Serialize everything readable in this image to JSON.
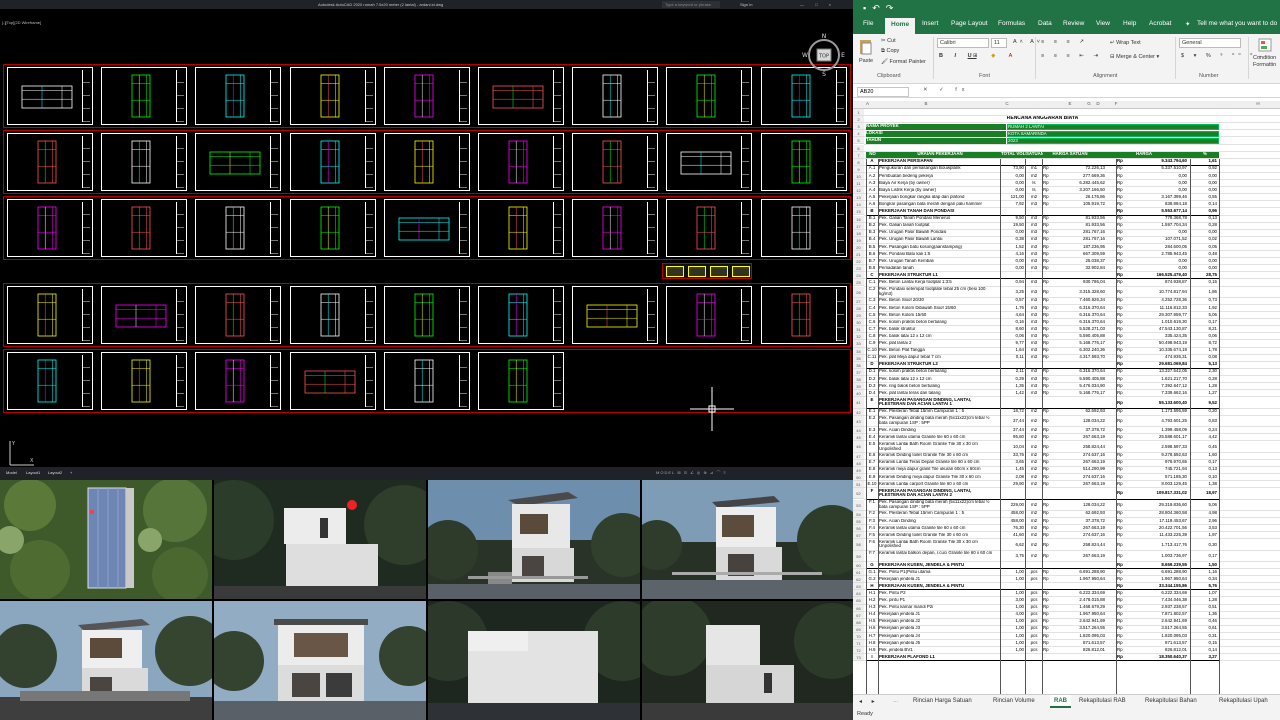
{
  "autocad": {
    "title": "Autodesk AutoCAD 2020   rumah 7.5x20 meter (2 lantai) - ardani.id.dwg",
    "search_placeholder": "Type a keyword or phrase",
    "user": "Sign In",
    "window_controls": "— □ ×",
    "viewport_label": "[-][Top][2D Wireframe]",
    "viewcube": {
      "face": "TOP",
      "north": "N",
      "south": "S",
      "east": "E",
      "west": "W"
    },
    "layout_tabs": [
      "Model",
      "Layout1",
      "Layout2",
      "+"
    ],
    "status_text": "MODEL  ⊞ ⊡ ∠ ◎ ⊕ ⊿ ⌒ ≡",
    "ucs": {
      "x": "X",
      "y": "Y"
    }
  },
  "excel": {
    "qat_icons": [
      "save-icon",
      "undo-icon",
      "redo-icon"
    ],
    "tabs": [
      "File",
      "Home",
      "Insert",
      "Page Layout",
      "Formulas",
      "Data",
      "Review",
      "View",
      "Help",
      "Acrobat",
      "Tell me what you want to do"
    ],
    "active_tab": "Home",
    "ribbon": {
      "paste": "Paste",
      "cut": "Cut",
      "copy": "Copy",
      "format_painter": "Format Painter",
      "clipboard": "Clipboard",
      "font_name": "Calibri",
      "font_size": "11",
      "font": "Font",
      "wrap_text": "Wrap Text",
      "merge_center": "Merge & Center",
      "alignment": "Alignment",
      "number_format": "General",
      "number": "Number",
      "conditional": "Condition\nFormattin"
    },
    "name_box": "AB20",
    "fx": "✕ ✓ fx",
    "columns": [
      "A",
      "B",
      "C",
      "D",
      "E",
      "F",
      "G",
      "H"
    ],
    "sheet_tabs": [
      "Rincian Harga Satuan",
      "Rincian Volume",
      "RAB",
      "Rekapitulasi RAB",
      "Rekapitulasi Bahan",
      "Rekapitulasi Upah"
    ],
    "active_sheet": "RAB",
    "status": "Ready",
    "doc_title": "RENCANA ANGGARAN BIAYA",
    "info": [
      {
        "label": "NAMA PROYEK",
        "value": "RUMAH 2 LANTAI"
      },
      {
        "label": "LOKASI",
        "value": "KOTA SAMARINDA"
      },
      {
        "label": "TAHUN",
        "value": "2023"
      }
    ],
    "header": [
      "NO",
      "URAIAN PEKERJAAN",
      "TOTAL VOLUM",
      "SATUAN",
      "HARGA SATUAN",
      "HARGA",
      "%"
    ],
    "rows": [
      {
        "r": "8",
        "no": "A",
        "desc": "PEKERJAAN PERSIAPAN",
        "vol": "",
        "sat": "",
        "hs": "",
        "rp": "Rp",
        "harga": "9.343.794,60",
        "pct": "1,61",
        "type": "sec"
      },
      {
        "r": "9",
        "no": "A.1",
        "desc": "Pengukuran dan pemasangan Bouwplank",
        "vol": "73,90",
        "sat": "m1",
        "hs": "72.226,13",
        "rp": "Rp",
        "harga": "5.337.510,97",
        "pct": "0,92"
      },
      {
        "r": "10",
        "no": "A.2",
        "desc": "Pembuatan bedeng pekerja",
        "vol": "0,00",
        "sat": "m2",
        "hs": "277.669,36",
        "rp": "Rp",
        "harga": "0,00",
        "pct": "0,00"
      },
      {
        "r": "11",
        "no": "A.3",
        "desc": "Biaya Air Kerja (by owner)",
        "vol": "0,00",
        "sat": "ls",
        "hs": "6.282.445,62",
        "rp": "Rp",
        "harga": "0,00",
        "pct": "0,00"
      },
      {
        "r": "12",
        "no": "A.4",
        "desc": "Biaya Listrik Kerja (by owner)",
        "vol": "0,00",
        "sat": "ls",
        "hs": "3.207.166,50",
        "rp": "Rp",
        "harga": "0,00",
        "pct": "0,00"
      },
      {
        "r": "13",
        "no": "A.5",
        "desc": "Pekerjaan bongkar rangka atap dan plafond",
        "vol": "121,00",
        "sat": "m2",
        "hs": "26.176,86",
        "rp": "Rp",
        "harga": "3.167.399,46",
        "pct": "0,55"
      },
      {
        "r": "14",
        "no": "A.6",
        "desc": "Bongkar pasangan bata merah dengan palu hammer",
        "vol": "7,92",
        "sat": "m3",
        "hs": "105.919,72",
        "rp": "Rp",
        "harga": "838.884,18",
        "pct": "0,14"
      },
      {
        "r": "15",
        "no": "B",
        "desc": "PEKERJAAN TANAH DAN PONDASI",
        "vol": "",
        "sat": "",
        "hs": "",
        "rp": "Rp",
        "harga": "5.553.677,14",
        "pct": "0,96",
        "type": "sec"
      },
      {
        "r": "16",
        "no": "B.1",
        "desc": "Pek. Galian Tanah Pondasi Menerus",
        "vol": "9,50",
        "sat": "m3",
        "hs": "81.933,56",
        "rp": "Rp",
        "harga": "778.368,78",
        "pct": "0,13"
      },
      {
        "r": "17",
        "no": "B.2",
        "desc": "Pek. Galian tanah footplat",
        "vol": "19,50",
        "sat": "m3",
        "hs": "81.933,56",
        "rp": "Rp",
        "harga": "1.597.704,34",
        "pct": "0,28"
      },
      {
        "r": "18",
        "no": "B.3",
        "desc": "Pek. Urugan Pasir Bawah Pondasi",
        "vol": "0,00",
        "sat": "m3",
        "hs": "281.767,16",
        "rp": "Rp",
        "harga": "0,00",
        "pct": "0,00"
      },
      {
        "r": "19",
        "no": "B.4",
        "desc": "Pek. Urugan Pasir Bawah Lantai",
        "vol": "0,38",
        "sat": "m3",
        "hs": "281.767,16",
        "rp": "Rp",
        "harga": "107.071,52",
        "pct": "0,02"
      },
      {
        "r": "20",
        "no": "B.5",
        "desc": "Pek. Pasangan batu kosong(aanstamping)",
        "vol": "1,52",
        "sat": "m3",
        "hs": "187.236,95",
        "rp": "Rp",
        "harga": "284.600,05",
        "pct": "0,05"
      },
      {
        "r": "21",
        "no": "B.6",
        "desc": "Pek. Pondasi Batu kali 1:5",
        "vol": "4,16",
        "sat": "m3",
        "hs": "667.309,59",
        "rp": "Rp",
        "harga": "2.785.943,45",
        "pct": "0,48"
      },
      {
        "r": "22",
        "no": "B.7",
        "desc": "Pek. Urugan Tanah Kembali",
        "vol": "0,00",
        "sat": "m3",
        "hs": "25.038,37",
        "rp": "Rp",
        "harga": "0,00",
        "pct": "0,00"
      },
      {
        "r": "23",
        "no": "B.8",
        "desc": "Pemadatan tanah",
        "vol": "0,00",
        "sat": "m3",
        "hs": "32.902,84",
        "rp": "Rp",
        "harga": "0,00",
        "pct": "0,00"
      },
      {
        "r": "24",
        "no": "C",
        "desc": "PEKERJAAN STRUKTUR L1",
        "vol": "",
        "sat": "",
        "hs": "",
        "rp": "Rp",
        "harga": "166.525.479,40",
        "pct": "28,75",
        "type": "sec"
      },
      {
        "r": "25",
        "no": "C.1",
        "desc": "Pek. Beton Lantai Kerja footplat 1:3:5",
        "vol": "0,94",
        "sat": "m3",
        "hs": "930.786,04",
        "rp": "Rp",
        "harga": "874.938,87",
        "pct": "0,15"
      },
      {
        "r": "26",
        "no": "C.2",
        "desc": "Pek. Pondasi setempat footplate tebal 25 cm (besi 100 kg/m3)",
        "vol": "3,25",
        "sat": "m3",
        "hs": "3.315.328,60",
        "rp": "Rp",
        "harga": "10.774.817,94",
        "pct": "1,86",
        "tall": true
      },
      {
        "r": "27",
        "no": "C.3",
        "desc": "Pek. Beton Sloof 20/30",
        "vol": "0,57",
        "sat": "m3",
        "hs": "7.460.926,34",
        "rp": "Rp",
        "harga": "4.252.728,36",
        "pct": "0,73"
      },
      {
        "r": "28",
        "no": "C.4",
        "desc": "Pek. Beton Kolom Dibawah Sloof 15/60",
        "vol": "1,76",
        "sat": "m3",
        "hs": "6.316.370,64",
        "rp": "Rp",
        "harga": "11.116.812,33",
        "pct": "1,92"
      },
      {
        "r": "29",
        "no": "C.5",
        "desc": "Pek. Beton Kolom 15/60",
        "vol": "4,64",
        "sat": "m3",
        "hs": "6.316.370,64",
        "rp": "Rp",
        "harga": "29.307.959,77",
        "pct": "5,06"
      },
      {
        "r": "30",
        "no": "C.6",
        "desc": "Pek. kolom praktis beton bertulang",
        "vol": "0,16",
        "sat": "m3",
        "hs": "6.316.370,64",
        "rp": "Rp",
        "harga": "1.010.619,30",
        "pct": "0,17"
      },
      {
        "r": "31",
        "no": "C.7",
        "desc": "Pek. balok struktur",
        "vol": "8,60",
        "sat": "m3",
        "hs": "5.528.271,03",
        "rp": "Rp",
        "harga": "47.543.130,87",
        "pct": "8,21"
      },
      {
        "r": "32",
        "no": "C.8",
        "desc": "Pek. balok latai 12 x 12 cm",
        "vol": "0,06",
        "sat": "m3",
        "hs": "5.590.405,88",
        "rp": "Rp",
        "harga": "335.424,35",
        "pct": "0,06"
      },
      {
        "r": "33",
        "no": "C.9",
        "desc": "Pek. plat lantai 2",
        "vol": "9,77",
        "sat": "m3",
        "hs": "5.168.776,17",
        "rp": "Rp",
        "harga": "50.498.943,19",
        "pct": "8,72"
      },
      {
        "r": "34",
        "no": "C.10",
        "desc": "Pek. Beton Plat Tangga",
        "vol": "1,64",
        "sat": "m3",
        "hs": "6.302.240,36",
        "rp": "Rp",
        "harga": "10.335.674,19",
        "pct": "1,78"
      },
      {
        "r": "35",
        "no": "C.11",
        "desc": "Pek. plat Meja dapur tebal 7 cm",
        "vol": "0,11",
        "sat": "m3",
        "hs": "4.317.593,70",
        "rp": "Rp",
        "harga": "474.935,31",
        "pct": "0,08"
      },
      {
        "r": "36",
        "no": "D",
        "desc": "PEKERJAAN STRUKTUR L2",
        "vol": "",
        "sat": "",
        "hs": "",
        "rp": "Rp",
        "harga": "29.681.069,84",
        "pct": "5,13",
        "type": "sec"
      },
      {
        "r": "37",
        "no": "D.1",
        "desc": "Pek. kolom praktis beton bertulang",
        "vol": "2,11",
        "sat": "m3",
        "hs": "6.316.370,64",
        "rp": "Rp",
        "harga": "13.327.542,05",
        "pct": "2,30"
      },
      {
        "r": "38",
        "no": "D.2",
        "desc": "Pek. balok latai 12 x 12 cm",
        "vol": "0,29",
        "sat": "m3",
        "hs": "5.590.405,88",
        "rp": "Rp",
        "harga": "1.621.217,70",
        "pct": "0,28"
      },
      {
        "r": "39",
        "no": "D.3",
        "desc": "Pek. ring balok beton bertulang",
        "vol": "1,35",
        "sat": "m3",
        "hs": "5.476.034,90",
        "rp": "Rp",
        "harga": "7.392.647,12",
        "pct": "1,28"
      },
      {
        "r": "40",
        "no": "D.4",
        "desc": "Pek. plat lantai teras dan talang",
        "vol": "1,42",
        "sat": "m3",
        "hs": "5.168.776,17",
        "rp": "Rp",
        "harga": "7.339.662,16",
        "pct": "1,27"
      },
      {
        "r": "41",
        "no": "E",
        "desc": "PEKERJAAN PASANGAN DINDING, LANTAI, PLESTERAN DAN ACIAN LANTAI 1",
        "vol": "",
        "sat": "",
        "hs": "",
        "rp": "Rp",
        "harga": "55.133.600,40",
        "pct": "9,52",
        "type": "sec",
        "tall": true
      },
      {
        "r": "42",
        "no": "E.1",
        "desc": "Pek. Plesteran Tebal 15mm Campuran 1 : 5",
        "vol": "18,72",
        "sat": "m2",
        "hs": "62.692,93",
        "rp": "Rp",
        "harga": "1.173.595,59",
        "pct": "0,20"
      },
      {
        "r": "43",
        "no": "E.2",
        "desc": "Pek. Pasangan dinding bata merah (5x11x22)cm tebal ½ bata campuran 1SP : 5PP",
        "vol": "37,44",
        "sat": "m2",
        "hs": "128.034,22",
        "rp": "Rp",
        "harga": "4.793.601,25",
        "pct": "0,83",
        "tall": true
      },
      {
        "r": "44",
        "no": "E.3",
        "desc": "Pek. Acian Dinding",
        "vol": "37,44",
        "sat": "m2",
        "hs": "37.378,72",
        "rp": "Rp",
        "harga": "1.399.458,09",
        "pct": "0,24"
      },
      {
        "r": "45",
        "no": "E.4",
        "desc": "Keramik lantai utama Granite tile 60 x 60 cm",
        "vol": "95,60",
        "sat": "m2",
        "hs": "267.663,19",
        "rp": "Rp",
        "harga": "25.588.601,17",
        "pct": "4,42"
      },
      {
        "r": "46",
        "no": "E.5",
        "desc": "Keramik Lantai Bath Room Granite Tile 30 x 30 cm Unpolished",
        "vol": "10,04",
        "sat": "m2",
        "hs": "258.824,44",
        "rp": "Rp",
        "harga": "2.598.597,33",
        "pct": "0,45",
        "tall": true
      },
      {
        "r": "47",
        "no": "E.6",
        "desc": "Keramik Dinding toilet Granite Tile 30 x 60 cm",
        "vol": "33,76",
        "sat": "m2",
        "hs": "274.637,16",
        "rp": "Rp",
        "harga": "9.278.592,63",
        "pct": "1,60"
      },
      {
        "r": "48",
        "no": "E.7",
        "desc": "Keramik Lantai Teras Depan Granite tile 60 x 60 cm",
        "vol": "3,65",
        "sat": "m2",
        "hs": "267.663,19",
        "rp": "Rp",
        "harga": "976.970,65",
        "pct": "0,17"
      },
      {
        "r": "49",
        "no": "E.8",
        "desc": "Keramik meja dapur granit Tile ukuran 60cm x 60cm",
        "vol": "1,45",
        "sat": "m2",
        "hs": "514.290,99",
        "rp": "Rp",
        "harga": "745.721,94",
        "pct": "0,13"
      },
      {
        "r": "50",
        "no": "E.9",
        "desc": "Keramik Dinding meja dapur Granite Tile 30 x 60 cm",
        "vol": "2,08",
        "sat": "m2",
        "hs": "274.637,16",
        "rp": "Rp",
        "harga": "571.185,30",
        "pct": "0,10"
      },
      {
        "r": "51",
        "no": "E.10",
        "desc": "Keramik Lantai carport Granite tile 60 x 60 cm",
        "vol": "29,90",
        "sat": "m2",
        "hs": "267.663,19",
        "rp": "Rp",
        "harga": "8.003.129,45",
        "pct": "1,38"
      },
      {
        "r": "52",
        "no": "F",
        "desc": "PEKERJAAN PASANGAN DINDING, LANTAI, PLESTERAN DAN ACIAN LANTAI 2",
        "vol": "",
        "sat": "",
        "hs": "",
        "rp": "Rp",
        "harga": "109.817.331,02",
        "pct": "18,97",
        "type": "sec",
        "tall": true
      },
      {
        "r": "53",
        "no": "F.1",
        "desc": "Pek. Pasangan dinding bata merah (5x11x22)cm tebal ½ bata campuran 1SP : 5PP",
        "vol": "229,00",
        "sat": "m2",
        "hs": "128.034,22",
        "rp": "Rp",
        "harga": "29.319.836,60",
        "pct": "5,06",
        "tall": true
      },
      {
        "r": "54",
        "no": "F.2",
        "desc": "Pek. Plesteran Tebal 15mm Campuran 1 : 5",
        "vol": "458,00",
        "sat": "m2",
        "hs": "62.692,93",
        "rp": "Rp",
        "harga": "28.804.360,58",
        "pct": "4,98"
      },
      {
        "r": "55",
        "no": "F.3",
        "desc": "Pek. Acian Dinding",
        "vol": "458,00",
        "sat": "m2",
        "hs": "37.378,72",
        "rp": "Rp",
        "harga": "17.119.453,67",
        "pct": "2,96"
      },
      {
        "r": "56",
        "no": "F.4",
        "desc": "Keramik lantai utama Granite tile 60 x 60 cm",
        "vol": "76,30",
        "sat": "m2",
        "hs": "267.663,19",
        "rp": "Rp",
        "harga": "20.422.701,56",
        "pct": "3,53"
      },
      {
        "r": "57",
        "no": "F.5",
        "desc": "Keramik Dinding toilet Granite Tile 30 x 60 cm",
        "vol": "41,60",
        "sat": "m2",
        "hs": "274.637,16",
        "rp": "Rp",
        "harga": "11.433.225,39",
        "pct": "1,97"
      },
      {
        "r": "58",
        "no": "F.6",
        "desc": "Keramik Lantai Bath Room Granite Tile 30 x 30 cm Unpolished",
        "vol": "6,62",
        "sat": "m2",
        "hs": "258.824,44",
        "rp": "Rp",
        "harga": "1.713.417,76",
        "pct": "0,30",
        "tall": true
      },
      {
        "r": "59",
        "no": "F.7",
        "desc": "Keramik lantai balkon depan, r.cuci Granite tile 60 x 60 cm",
        "vol": "3,75",
        "sat": "m2",
        "hs": "267.663,19",
        "rp": "Rp",
        "harga": "1.003.736,97",
        "pct": "0,17",
        "tall": true
      },
      {
        "r": "60",
        "no": "G",
        "desc": "PEKERJAAN KUSEN, JENDELA & PINTU",
        "vol": "",
        "sat": "",
        "hs": "",
        "rp": "Rp",
        "harga": "8.659.239,55",
        "pct": "1,50",
        "type": "sec"
      },
      {
        "r": "61",
        "no": "G.1",
        "desc": "Pek. Pintu P1(Pintu utama",
        "vol": "1,00",
        "sat": "pcs",
        "hs": "6.691.288,90",
        "rp": "Rp",
        "harga": "6.691.288,90",
        "pct": "1,16"
      },
      {
        "r": "62",
        "no": "G.2",
        "desc": "Pekerjaan jendela J1",
        "vol": "1,00",
        "sat": "pcs",
        "hs": "1.967.950,64",
        "rp": "Rp",
        "harga": "1.967.950,64",
        "pct": "0,34"
      },
      {
        "r": "63",
        "no": "H",
        "desc": "PEKERJAAN KUSEN, JENDELA & PINTU",
        "vol": "",
        "sat": "",
        "hs": "",
        "rp": "Rp",
        "harga": "33.344.155,86",
        "pct": "5,76",
        "type": "sec"
      },
      {
        "r": "64",
        "no": "H.1",
        "desc": "Pek. Pintu P2",
        "vol": "1,00",
        "sat": "pcs",
        "hs": "6.222.334,69",
        "rp": "Rp",
        "harga": "6.222.334,69",
        "pct": "1,07"
      },
      {
        "r": "65",
        "no": "H.2",
        "desc": "Pek. pintu P1",
        "vol": "3,00",
        "sat": "pcs",
        "hs": "2.478.015,88",
        "rp": "Rp",
        "harga": "7.434.046,38",
        "pct": "1,28"
      },
      {
        "r": "66",
        "no": "H.3",
        "desc": "Pek. Pintu kamar mandi P2i",
        "vol": "1,00",
        "sat": "pcs",
        "hs": "1.468.679,29",
        "rp": "Rp",
        "harga": "2.937.238,57",
        "pct": "0,51"
      },
      {
        "r": "67",
        "no": "H.4",
        "desc": "Pekerjaan jendela J1",
        "vol": "4,00",
        "sat": "pcs",
        "hs": "1.967.950,64",
        "rp": "Rp",
        "harga": "7.871.802,57",
        "pct": "1,36"
      },
      {
        "r": "68",
        "no": "H.5",
        "desc": "Pekerjaan jendela J2",
        "vol": "1,00",
        "sat": "pcs",
        "hs": "2.642.941,69",
        "rp": "Rp",
        "harga": "2.642.941,69",
        "pct": "0,46"
      },
      {
        "r": "69",
        "no": "H.6",
        "desc": "Pekerjaan jendela J3",
        "vol": "1,00",
        "sat": "pcs",
        "hs": "3.517.264,55",
        "rp": "Rp",
        "harga": "3.517.264,55",
        "pct": "0,61"
      },
      {
        "r": "70",
        "no": "H.7",
        "desc": "Pekerjaan jendela J4",
        "vol": "1,00",
        "sat": "pcs",
        "hs": "1.820.095,03",
        "rp": "Rp",
        "harga": "1.820.095,03",
        "pct": "0,31"
      },
      {
        "r": "71",
        "no": "H.8",
        "desc": "Pekerjaan jendela J5",
        "vol": "1,00",
        "sat": "pcs",
        "hs": "871.613,57",
        "rp": "Rp",
        "harga": "871.613,57",
        "pct": "0,15"
      },
      {
        "r": "72",
        "no": "H.9",
        "desc": "Pek. jendela BV1",
        "vol": "1,00",
        "sat": "pcs",
        "hs": "826.812,01",
        "rp": "Rp",
        "harga": "826.812,01",
        "pct": "0,14"
      },
      {
        "r": "73",
        "no": "I",
        "desc": "PEKERJAAN PLAFOND L1",
        "vol": "",
        "sat": "",
        "hs": "",
        "rp": "Rp",
        "harga": "18.350.640,37",
        "pct": "3,27",
        "type": "sec"
      }
    ]
  }
}
